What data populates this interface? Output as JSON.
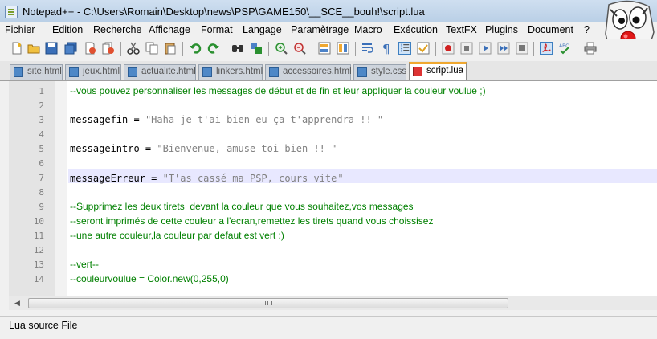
{
  "window": {
    "title": "Notepad++ - C:\\Users\\Romain\\Desktop\\news\\PSP\\GAME150\\__SCE__bouh!\\script.lua"
  },
  "menu": [
    "Fichier",
    "Edition",
    "Recherche",
    "Affichage",
    "Format",
    "Langage",
    "Paramètrage",
    "Macro",
    "Exécution",
    "TextFX",
    "Plugins",
    "Document",
    "?"
  ],
  "toolbar": {
    "icons": [
      "new-file-icon",
      "open-file-icon",
      "save-icon",
      "save-all-icon",
      "close-icon",
      "close-all-icon",
      "print-icon",
      "cut-icon",
      "copy-icon",
      "paste-icon",
      "undo-icon",
      "redo-icon",
      "find-icon",
      "replace-icon",
      "zoom-in-icon",
      "zoom-out-icon",
      "sync-v-icon",
      "sync-h-icon",
      "word-wrap-icon",
      "show-all-chars-icon",
      "indent-guide-icon",
      "user-lang-icon",
      "record-macro-icon",
      "stop-macro-icon",
      "play-macro-icon",
      "run-macro-multiple-icon",
      "save-macro-icon",
      "pdf-icon",
      "spellcheck-icon",
      "print-now-icon"
    ]
  },
  "tabs": [
    {
      "label": "site.html",
      "active": false
    },
    {
      "label": "jeux.html",
      "active": false
    },
    {
      "label": "actualite.html",
      "active": false
    },
    {
      "label": "linkers.html",
      "active": false
    },
    {
      "label": "accessoires.html",
      "active": false
    },
    {
      "label": "style.css",
      "active": false
    },
    {
      "label": "script.lua",
      "active": true
    }
  ],
  "editor": {
    "lines": [
      {
        "n": "1",
        "type": "comment",
        "text": "--vous pouvez personnaliser les messages de début et de fin et leur appliquer la couleur voulue ;)"
      },
      {
        "n": "2",
        "type": "empty",
        "text": ""
      },
      {
        "n": "3",
        "type": "code",
        "name": "messagefin",
        "op": " = ",
        "value": "\"Haha je t'ai bien eu ça t'apprendra !! \""
      },
      {
        "n": "4",
        "type": "empty",
        "text": ""
      },
      {
        "n": "5",
        "type": "code",
        "name": "messageintro",
        "op": " = ",
        "value": "\"Bienvenue, amuse-toi bien !! \""
      },
      {
        "n": "6",
        "type": "empty",
        "text": ""
      },
      {
        "n": "7",
        "type": "code",
        "name": "messageErreur",
        "op": " = ",
        "value": "\"T'as cassé ma PSP, cours vite",
        "value_tail": "\"",
        "current": true
      },
      {
        "n": "8",
        "type": "empty",
        "text": ""
      },
      {
        "n": "9",
        "type": "comment",
        "text": "--Supprimez les deux tirets  devant la couleur que vous souhaitez,vos messages"
      },
      {
        "n": "10",
        "type": "comment",
        "text": "--seront imprimés de cette couleur a l'ecran,remettez les tirets quand vous choissisez"
      },
      {
        "n": "11",
        "type": "comment",
        "text": "--une autre couleur,la couleur par defaut est vert :)"
      },
      {
        "n": "12",
        "type": "empty",
        "text": ""
      },
      {
        "n": "13",
        "type": "comment",
        "text": "--vert--"
      },
      {
        "n": "14",
        "type": "comment",
        "text": "--couleurvoulue = Color.new(0,255,0)"
      }
    ]
  },
  "statusbar": {
    "text": "Lua source File"
  },
  "colors": {
    "comment": "#008000",
    "code": "#000000",
    "string": "#808080",
    "current_line": "#e8e8ff",
    "active_tab_accent": "#f0a830"
  }
}
